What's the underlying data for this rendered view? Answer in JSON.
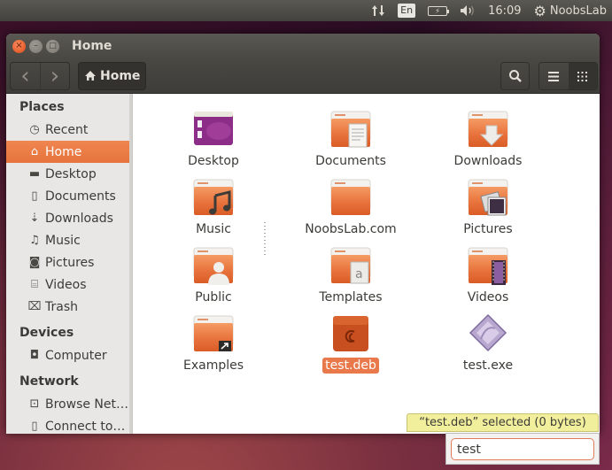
{
  "top_panel": {
    "keyboard_layout": "En",
    "clock": "16:09",
    "session_user": "NoobsLab",
    "icons": [
      "network-updown-icon",
      "keyboard-layout-icon",
      "battery-charging-icon",
      "volume-icon",
      "session-gear-icon"
    ]
  },
  "window": {
    "title": "Home",
    "buttons": {
      "close": "×",
      "minimize": "–",
      "maximize": "□"
    }
  },
  "toolbar": {
    "back_glyph": "‹",
    "forward_glyph": "›",
    "path_label": "Home",
    "home_glyph": "⌂",
    "search_icon": "search-icon",
    "list_view_icon": "list-view-icon",
    "grid_view_icon": "grid-view-icon",
    "active_view": "grid"
  },
  "sidebar": {
    "sections": [
      {
        "heading": "Places",
        "items": [
          {
            "label": "Recent",
            "icon": "clock-icon",
            "glyph": "◷"
          },
          {
            "label": "Home",
            "icon": "home-icon",
            "glyph": "⌂",
            "active": true
          },
          {
            "label": "Desktop",
            "icon": "folder-icon",
            "glyph": "▬"
          },
          {
            "label": "Documents",
            "icon": "document-icon",
            "glyph": "▯"
          },
          {
            "label": "Downloads",
            "icon": "download-icon",
            "glyph": "⇣"
          },
          {
            "label": "Music",
            "icon": "music-icon",
            "glyph": "♫"
          },
          {
            "label": "Pictures",
            "icon": "camera-icon",
            "glyph": "◙"
          },
          {
            "label": "Videos",
            "icon": "film-icon",
            "glyph": "⌸"
          },
          {
            "label": "Trash",
            "icon": "trash-icon",
            "glyph": "⌧"
          }
        ]
      },
      {
        "heading": "Devices",
        "items": [
          {
            "label": "Computer",
            "icon": "harddisk-icon",
            "glyph": "◘"
          }
        ]
      },
      {
        "heading": "Network",
        "items": [
          {
            "label": "Browse Net…",
            "icon": "network-icon",
            "glyph": "⊡"
          },
          {
            "label": "Connect to…",
            "icon": "server-icon",
            "glyph": "▯"
          }
        ]
      }
    ]
  },
  "files": [
    {
      "name": "Desktop",
      "type": "desktop-folder"
    },
    {
      "name": "Documents",
      "type": "folder",
      "emblem": "document"
    },
    {
      "name": "Downloads",
      "type": "folder",
      "emblem": "download"
    },
    {
      "name": "Music",
      "type": "folder",
      "emblem": "music"
    },
    {
      "name": "NoobsLab.com",
      "type": "folder"
    },
    {
      "name": "Pictures",
      "type": "folder",
      "emblem": "pictures"
    },
    {
      "name": "Public",
      "type": "folder",
      "emblem": "person"
    },
    {
      "name": "Templates",
      "type": "folder",
      "emblem": "template"
    },
    {
      "name": "Videos",
      "type": "folder",
      "emblem": "film"
    },
    {
      "name": "Examples",
      "type": "folder",
      "emblem": "link"
    },
    {
      "name": "test.deb",
      "type": "deb-package",
      "selected": true
    },
    {
      "name": "test.exe",
      "type": "wine-executable"
    }
  ],
  "status": {
    "text": "“test.deb” selected  (0 bytes)"
  },
  "type_ahead": {
    "value": "test"
  },
  "colors": {
    "accent": "#e9784a",
    "panel": "#4a4843",
    "status_bg": "#f2ef9c"
  }
}
